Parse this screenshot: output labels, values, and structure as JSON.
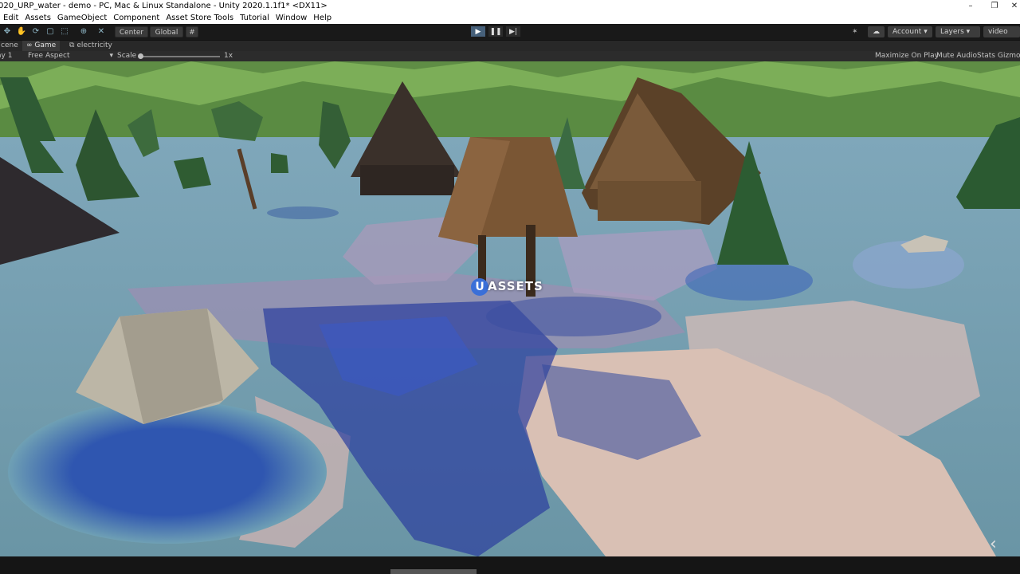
{
  "window": {
    "title": "020_URP_water - demo - PC, Mac & Linux Standalone - Unity 2020.1.1f1* <DX11>",
    "minimize": "–",
    "maximize": "❐",
    "close": "✕"
  },
  "menu": [
    "Edit",
    "Assets",
    "GameObject",
    "Component",
    "Asset Store Tools",
    "Tutorial",
    "Window",
    "Help"
  ],
  "toolbar": {
    "tools": [
      "✥",
      "✋",
      "⟳",
      "▢",
      "⬚",
      "⊕",
      "✕"
    ],
    "pivot_label": "Center",
    "space_label": "Global",
    "snap_icon": "#",
    "play_icon": "▶",
    "pause_icon": "❚❚",
    "step_icon": "▶|",
    "collab_icon": "✶",
    "cloud_icon": "☁",
    "account_label": "Account",
    "layers_label": "Layers",
    "layout_label": "video"
  },
  "tabs": [
    {
      "label": "cene"
    },
    {
      "label": "Game",
      "icon": "∞"
    },
    {
      "label": "electricity",
      "icon": "⧉"
    }
  ],
  "gamebar": {
    "display": "ay 1",
    "aspect": "Free Aspect",
    "scale_label": "Scale",
    "scale_value": "1x",
    "maximize": "Maximize On Play",
    "mute": "Mute Audio",
    "stats": "Stats",
    "gizmos": "Gizmos"
  },
  "watermark": {
    "badge": "U",
    "text": "ASSETS"
  },
  "colors": {
    "water": "#6f9cb0",
    "hill": "#6b9a4d",
    "house_wood": "#6a4a2d",
    "rock": "#b9b4a5",
    "caustics": "#2b3d9e"
  },
  "icons": [
    "back-arrow-icon",
    "play-icon",
    "pause-icon",
    "step-icon",
    "cloud-icon"
  ]
}
